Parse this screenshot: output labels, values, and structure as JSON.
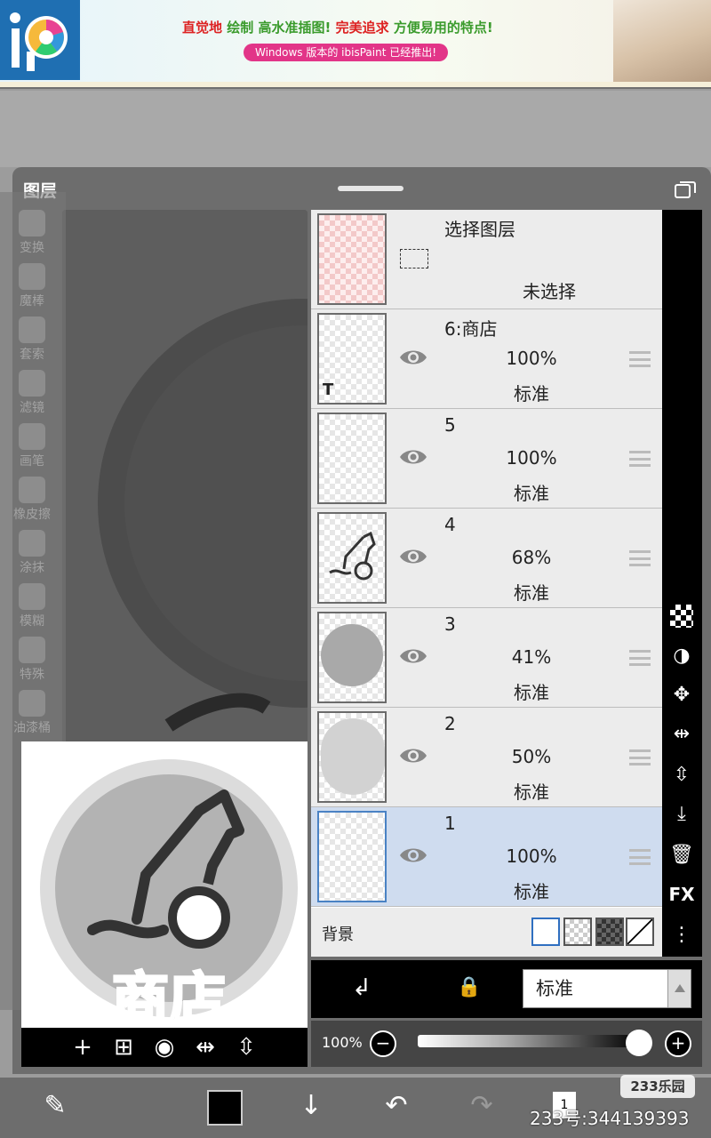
{
  "ad": {
    "line1_red1": "直觉地",
    "line1_green1": "绘制",
    "line1_green2": "高水准插图!",
    "line1_red2": "完美追求",
    "line1_green3": "方便易用的特点!",
    "button_text": "Windows 版本的 ibisPaint 已经推出!"
  },
  "panel": {
    "title": "图层"
  },
  "tools": [
    "变换",
    "魔棒",
    "套索",
    "滤镜",
    "画笔",
    "橡皮擦",
    "涂抹",
    "模糊",
    "特殊",
    "油漆桶"
  ],
  "layers": [
    {
      "name": "选择图层",
      "status": "未选择"
    },
    {
      "name": "6:商店",
      "opacity": "100%",
      "blend": "标准"
    },
    {
      "name": "5",
      "opacity": "100%",
      "blend": "标准"
    },
    {
      "name": "4",
      "opacity": "68%",
      "blend": "标准"
    },
    {
      "name": "3",
      "opacity": "41%",
      "blend": "标准"
    },
    {
      "name": "2",
      "opacity": "50%",
      "blend": "标准"
    },
    {
      "name": "1",
      "opacity": "100%",
      "blend": "标准"
    }
  ],
  "background": {
    "label": "背景"
  },
  "preview": {
    "text": "商店"
  },
  "blend_bar": {
    "mode": "标准"
  },
  "opacity_bar": {
    "value": "100%",
    "fraction": 1.0
  },
  "right_toolbar": {
    "fx_label": "FX"
  },
  "watermark": {
    "logo": "233乐园",
    "text": "233号:344139393"
  },
  "bottom_bar": {
    "page_number": "1"
  }
}
